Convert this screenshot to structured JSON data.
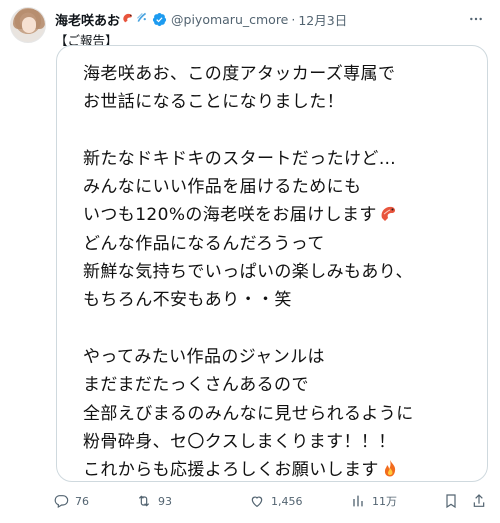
{
  "post": {
    "author": {
      "display_name": "海老咲あお",
      "name_emojis": [
        "shrimp-emoji",
        "splash-emoji"
      ],
      "verified": true,
      "handle": "@piyomaru_cmore",
      "separator": "·",
      "date": "12月3日"
    },
    "tag": "【ご報告】",
    "image_text_lines": [
      "海老咲あお、この度アタッカーズ専属で",
      "お世話になることになりました！",
      "",
      "新たなドキドキのスタートだったけど…",
      "みんなにいい作品を届けるためにも",
      "いつも120%の海老咲をお届けします",
      "どんな作品になるんだろうって",
      "新鮮な気持ちでいっぱいの楽しみもあり、",
      "もちろん不安もあり・・笑",
      "",
      "やってみたい作品のジャンルは",
      "まだまだたっくさんあるので",
      "全部えびまるのみんなに見せられるように",
      "粉骨砕身、セ〇クスしまくります！！！",
      "これからも応援よろしくお願いします"
    ],
    "inline_emojis": {
      "line_6": "shrimp-emoji",
      "line_15": "fire-emoji"
    },
    "actions": {
      "replies": "76",
      "reposts": "93",
      "likes": "1,456",
      "views": "11万"
    }
  },
  "colors": {
    "text": "#0f1419",
    "secondary": "#536471",
    "verified_blue": "#1d9bf0",
    "border": "#cfd9de",
    "shrimp": "#e8553d",
    "fire": "#f26b1d"
  }
}
